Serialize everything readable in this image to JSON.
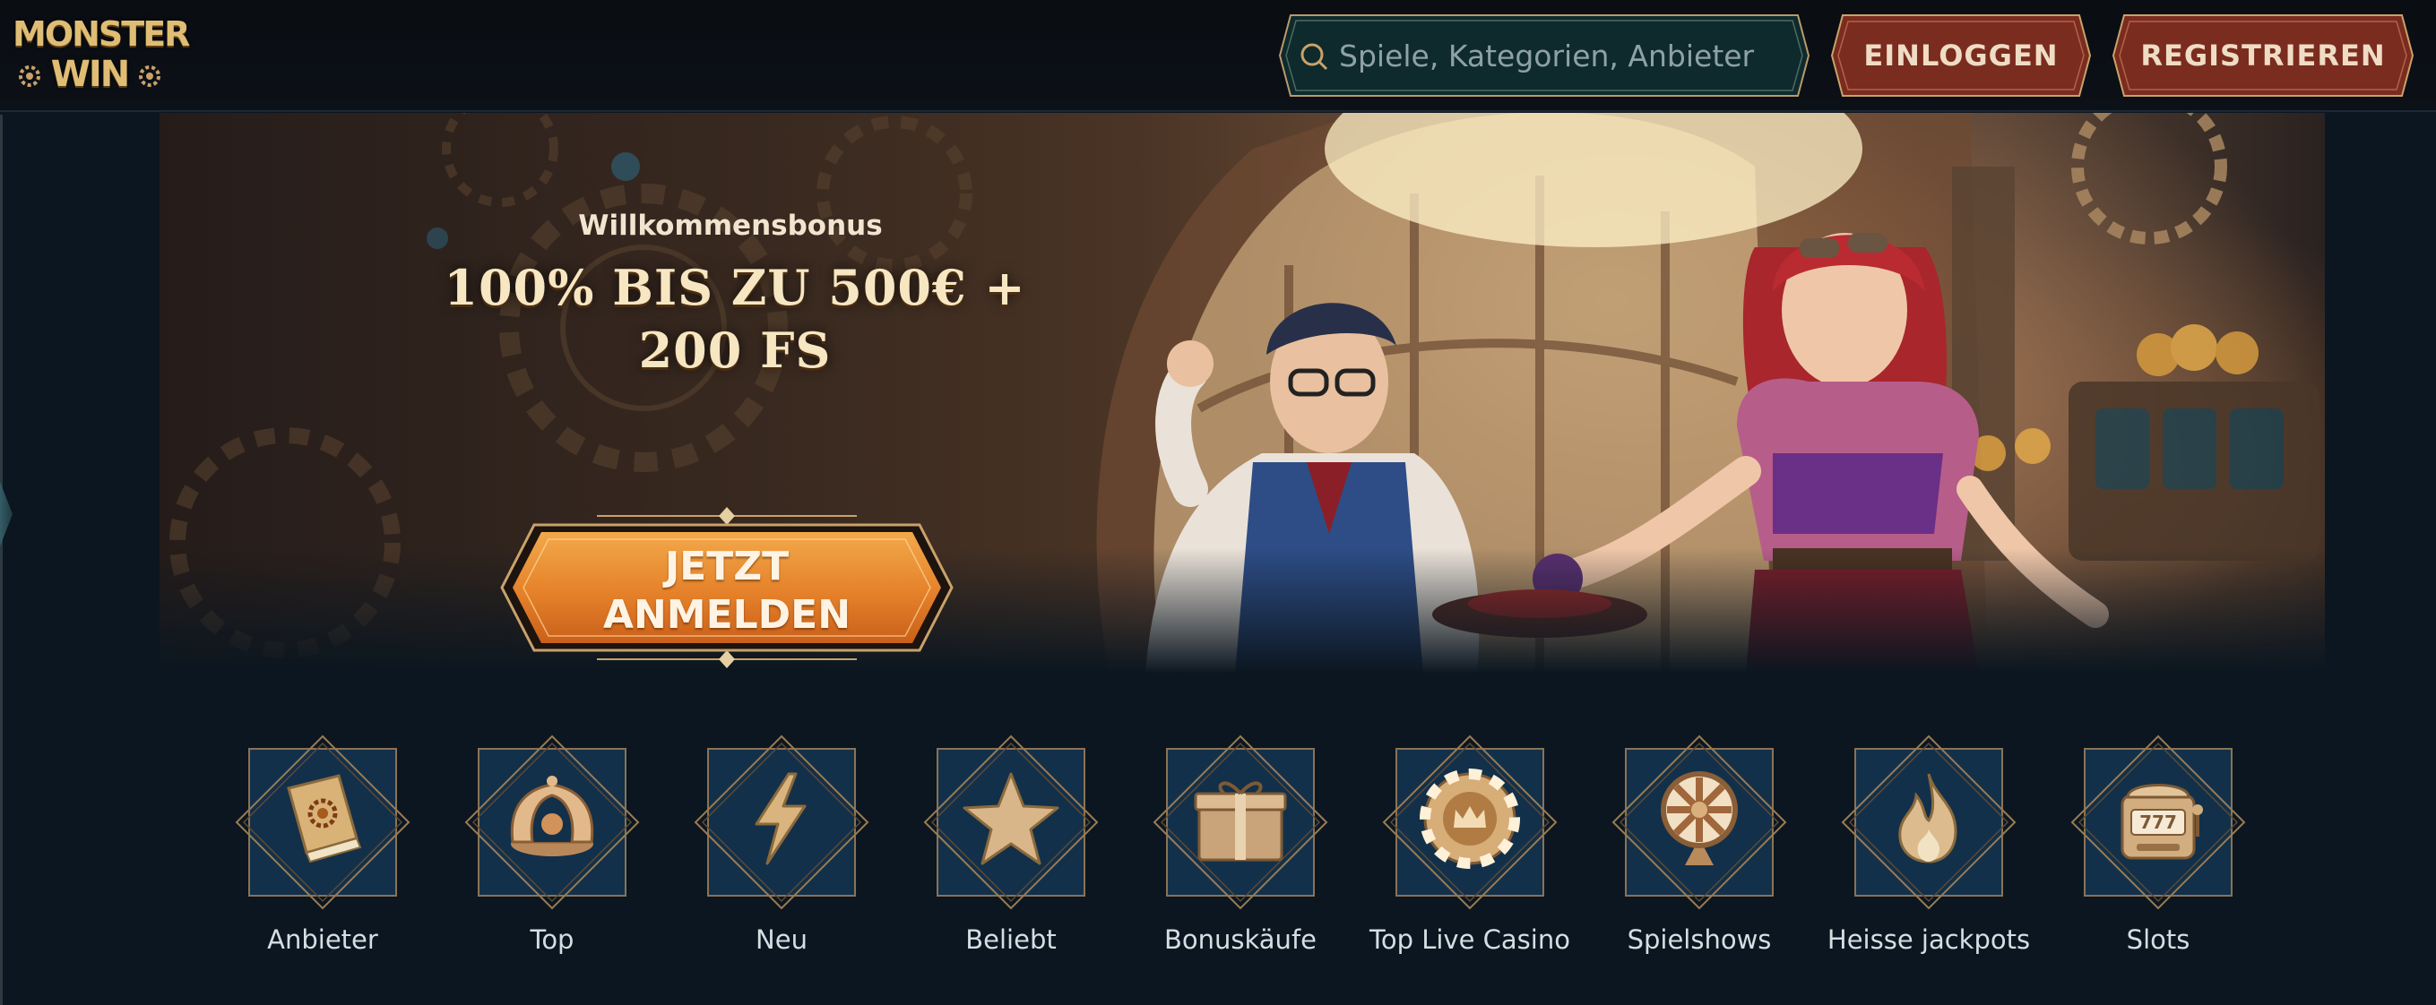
{
  "header": {
    "logo_line1": "MONSTER",
    "logo_line2": "WIN",
    "search_placeholder": "Spiele, Kategorien, Anbieter",
    "login_label": "EINLOGGEN",
    "register_label": "REGISTRIEREN"
  },
  "hero": {
    "subtitle": "Willkommensbonus",
    "title": "100% BIS ZU 500€ + 200 FS",
    "cta_label": "JETZT ANMELDEN"
  },
  "categories": [
    {
      "label": "Anbieter",
      "icon": "book-icon"
    },
    {
      "label": "Top",
      "icon": "crown-icon"
    },
    {
      "label": "Neu",
      "icon": "lightning-icon"
    },
    {
      "label": "Beliebt",
      "icon": "star-icon"
    },
    {
      "label": "Bonuskäufe",
      "icon": "gift-box-icon"
    },
    {
      "label": "Top Live Casino",
      "icon": "casino-chip-icon"
    },
    {
      "label": "Spielshows",
      "icon": "fortune-wheel-icon"
    },
    {
      "label": "Heisse jackpots",
      "icon": "flame-icon"
    },
    {
      "label": "Slots",
      "icon": "slot-machine-icon"
    }
  ],
  "colors": {
    "background": "#0b1620",
    "gold": "#c9a26a",
    "button_red": "#7a2c1f",
    "cta_orange": "#e58326",
    "search_bg": "#0e2a2c"
  }
}
